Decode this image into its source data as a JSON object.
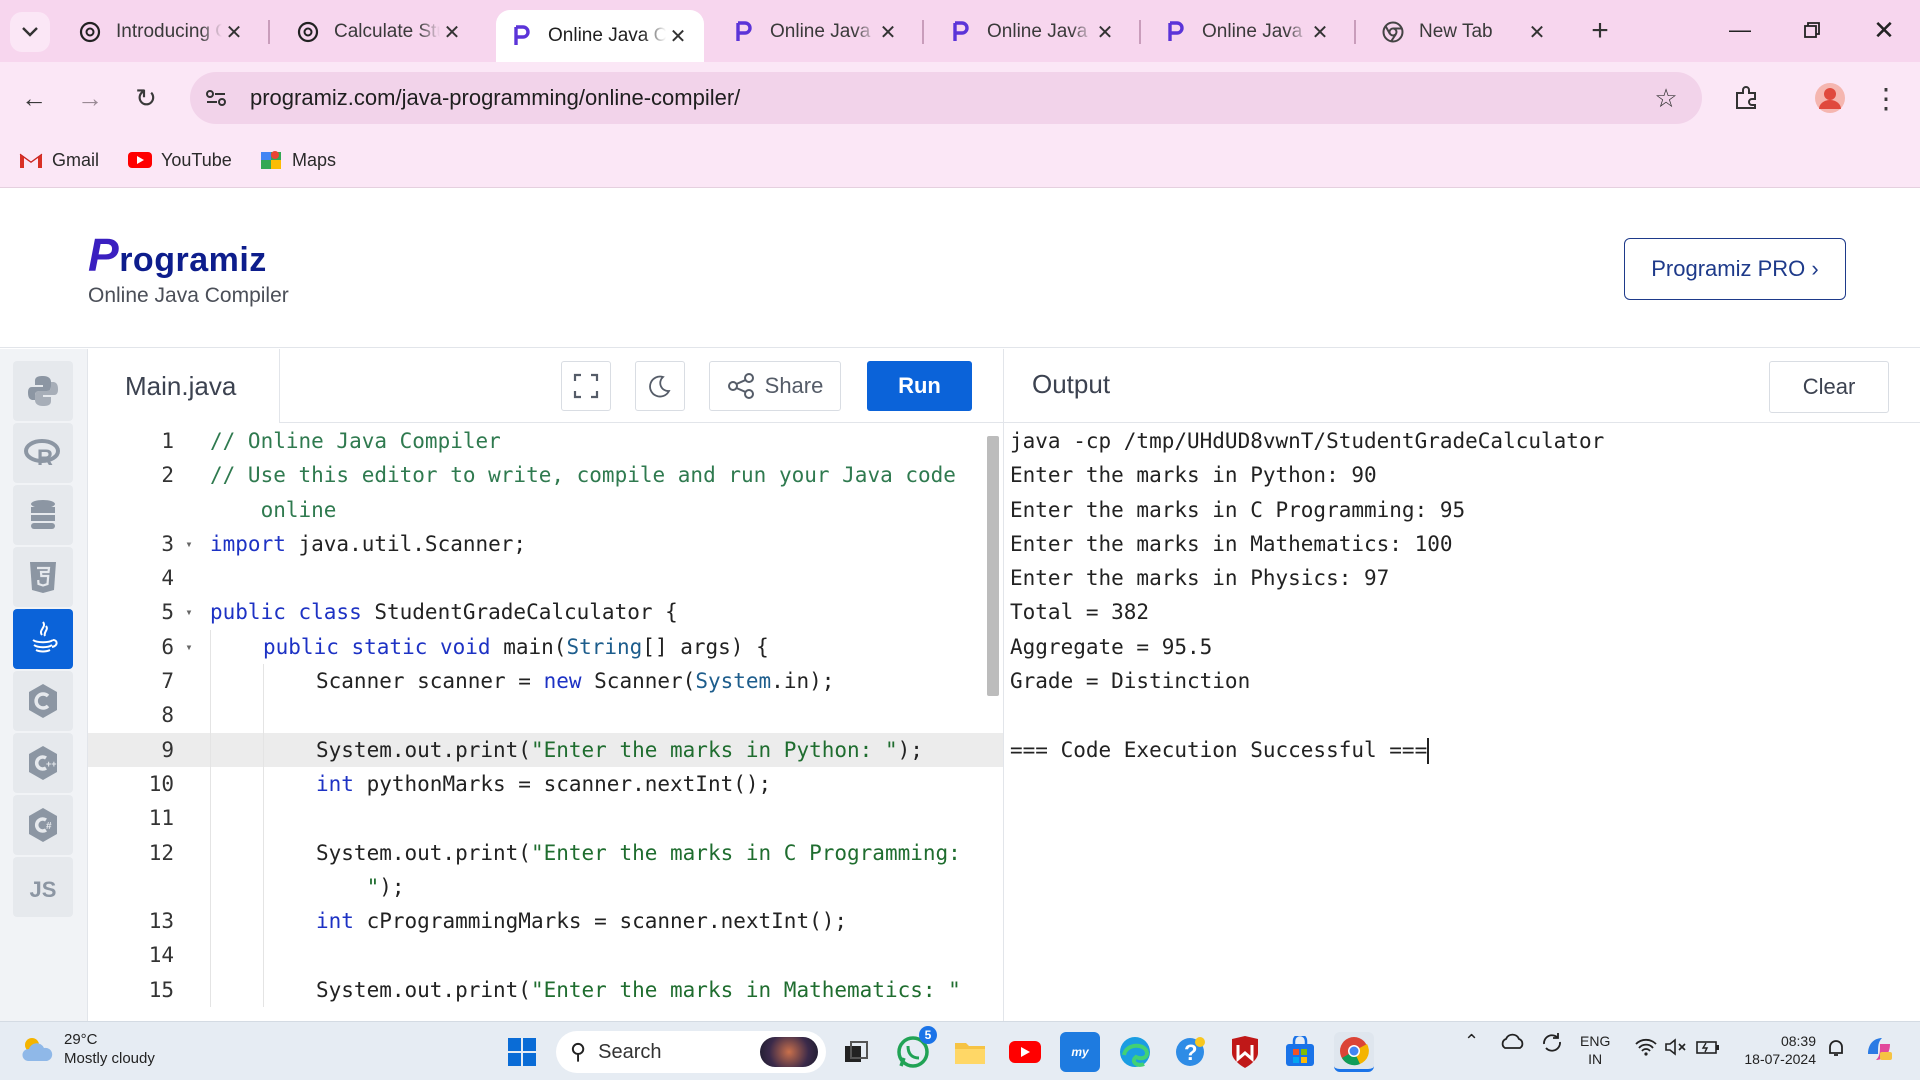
{
  "browser": {
    "tabs": [
      {
        "title": "Introducing ChatGPT",
        "favicon": "openai-icon",
        "active": false
      },
      {
        "title": "Calculate Student Grade",
        "favicon": "openai-icon",
        "active": false
      },
      {
        "title": "Online Java Compiler",
        "favicon": "programiz-icon",
        "active": true
      },
      {
        "title": "Online Java Compiler",
        "favicon": "programiz-icon",
        "active": false
      },
      {
        "title": "Online Java Compiler",
        "favicon": "programiz-icon",
        "active": false
      },
      {
        "title": "Online Java Compiler",
        "favicon": "programiz-icon",
        "active": false
      },
      {
        "title": "New Tab",
        "favicon": "chrome-icon",
        "active": false
      }
    ],
    "url": "programiz.com/java-programming/online-compiler/",
    "bookmarks": [
      {
        "label": "Gmail",
        "icon": "gmail-icon"
      },
      {
        "label": "YouTube",
        "icon": "youtube-icon"
      },
      {
        "label": "Maps",
        "icon": "maps-icon"
      }
    ],
    "theme_color": "#f7d6ee"
  },
  "header": {
    "logo_text": "Programiz",
    "subtitle": "Online Java Compiler",
    "pro_button": "Programiz PRO ›"
  },
  "editor": {
    "file_name": "Main.java",
    "share_label": "Share",
    "run_label": "Run",
    "accent_color": "#0b63d9",
    "lines": [
      {
        "n": "1",
        "fold": "",
        "indent": 0,
        "tokens": [
          [
            "com",
            "// Online Java Compiler"
          ]
        ]
      },
      {
        "n": "2",
        "fold": "",
        "indent": 0,
        "tokens": [
          [
            "com",
            "// Use this editor to write, compile and run your Java code\n    online"
          ]
        ]
      },
      {
        "n": "3",
        "fold": "▾",
        "indent": 0,
        "tokens": [
          [
            "kw",
            "import"
          ],
          [
            "",
            " java.util.Scanner;"
          ]
        ]
      },
      {
        "n": "4",
        "fold": "",
        "indent": 0,
        "tokens": [
          [
            "",
            ""
          ]
        ]
      },
      {
        "n": "5",
        "fold": "▾",
        "indent": 0,
        "tokens": [
          [
            "kw",
            "public class"
          ],
          [
            "",
            " StudentGradeCalculator {"
          ]
        ]
      },
      {
        "n": "6",
        "fold": "▾",
        "indent": 1,
        "tokens": [
          [
            "kw",
            "public static void"
          ],
          [
            "",
            " main("
          ],
          [
            "ty",
            "String"
          ],
          [
            "",
            "[] args) {"
          ]
        ]
      },
      {
        "n": "7",
        "fold": "",
        "indent": 2,
        "tokens": [
          [
            "",
            "Scanner scanner = "
          ],
          [
            "kw",
            "new"
          ],
          [
            "",
            " Scanner("
          ],
          [
            "ty",
            "System"
          ],
          [
            "",
            ".in);"
          ]
        ]
      },
      {
        "n": "8",
        "fold": "",
        "indent": 2,
        "tokens": [
          [
            "",
            ""
          ]
        ]
      },
      {
        "n": "9",
        "fold": "",
        "indent": 2,
        "highlight": true,
        "tokens": [
          [
            "",
            "System.out.print("
          ],
          [
            "str",
            "\"Enter the marks in Python: \""
          ],
          [
            "",
            ");"
          ]
        ]
      },
      {
        "n": "10",
        "fold": "",
        "indent": 2,
        "tokens": [
          [
            "kw",
            "int"
          ],
          [
            "",
            " pythonMarks = scanner.nextInt();"
          ]
        ]
      },
      {
        "n": "11",
        "fold": "",
        "indent": 2,
        "tokens": [
          [
            "",
            ""
          ]
        ]
      },
      {
        "n": "12",
        "fold": "",
        "indent": 2,
        "tokens": [
          [
            "",
            "System.out.print("
          ],
          [
            "str",
            "\"Enter the marks in C Programming:\n    \""
          ],
          [
            "",
            ");"
          ]
        ]
      },
      {
        "n": "13",
        "fold": "",
        "indent": 2,
        "tokens": [
          [
            "kw",
            "int"
          ],
          [
            "",
            " cProgrammingMarks = scanner.nextInt();"
          ]
        ]
      },
      {
        "n": "14",
        "fold": "",
        "indent": 2,
        "tokens": [
          [
            "",
            ""
          ]
        ]
      },
      {
        "n": "15",
        "fold": "",
        "indent": 2,
        "tokens": [
          [
            "",
            "System.out.print("
          ],
          [
            "str",
            "\"Enter the marks in Mathematics: \""
          ]
        ]
      }
    ]
  },
  "output": {
    "title": "Output",
    "clear_label": "Clear",
    "lines": [
      "java -cp /tmp/UHdUD8vwnT/StudentGradeCalculator",
      "Enter the marks in Python: 90",
      "Enter the marks in C Programming: 95",
      "Enter the marks in Mathematics: 100",
      "Enter the marks in Physics: 97",
      "Total = 382",
      "Aggregate = 95.5",
      "Grade = Distinction",
      "",
      "=== Code Execution Successful ==="
    ]
  },
  "rail": {
    "items": [
      "python-icon",
      "r-icon",
      "sql-icon",
      "html5-icon",
      "java-icon",
      "c-icon",
      "cpp-icon",
      "csharp-icon",
      "js-icon"
    ],
    "js_label": "JS"
  },
  "taskbar": {
    "temperature": "29°C",
    "weather": "Mostly cloudy",
    "search_placeholder": "Search",
    "whatsapp_badge": "5",
    "lang_top": "ENG",
    "lang_bottom": "IN",
    "time": "08:39",
    "date": "18-07-2024"
  }
}
